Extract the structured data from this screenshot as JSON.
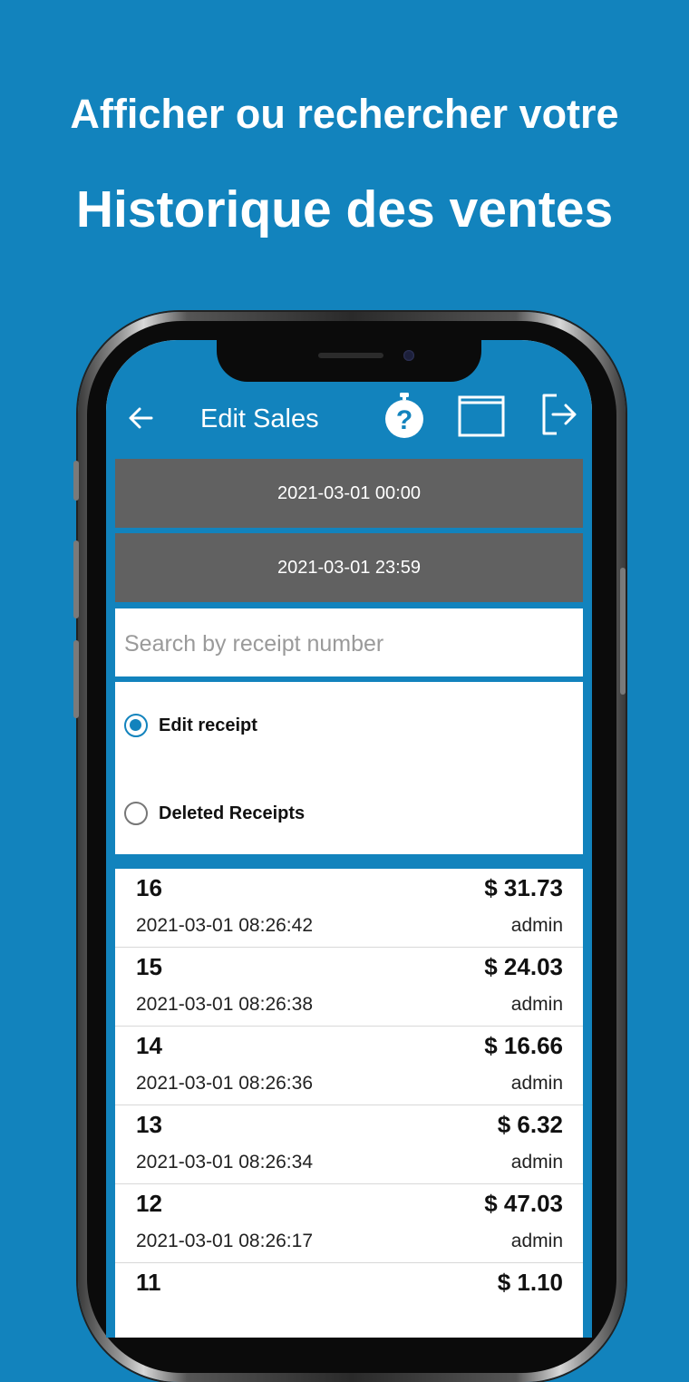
{
  "headline": {
    "line1": "Afficher ou rechercher votre",
    "line2": "Historique des ventes"
  },
  "appbar": {
    "title": "Edit Sales",
    "icons": [
      "back-arrow-icon",
      "help-icon",
      "window-icon",
      "logout-icon"
    ]
  },
  "filters": {
    "start_datetime": "2021-03-01 00:00",
    "end_datetime": "2021-03-01 23:59",
    "search_placeholder": "Search by receipt number",
    "search_value": ""
  },
  "mode": {
    "options": [
      {
        "label": "Edit receipt",
        "selected": true
      },
      {
        "label": "Deleted Receipts",
        "selected": false
      }
    ]
  },
  "receipts": [
    {
      "number": "16",
      "amount": "$ 31.73",
      "datetime": "2021-03-01 08:26:42",
      "user": "admin"
    },
    {
      "number": "15",
      "amount": "$ 24.03",
      "datetime": "2021-03-01 08:26:38",
      "user": "admin"
    },
    {
      "number": "14",
      "amount": "$ 16.66",
      "datetime": "2021-03-01 08:26:36",
      "user": "admin"
    },
    {
      "number": "13",
      "amount": "$ 6.32",
      "datetime": "2021-03-01 08:26:34",
      "user": "admin"
    },
    {
      "number": "12",
      "amount": "$ 47.03",
      "datetime": "2021-03-01 08:26:17",
      "user": "admin"
    },
    {
      "number": "11",
      "amount": "$ 1.10",
      "datetime": "",
      "user": ""
    }
  ],
  "colors": {
    "brand_blue": "#1283bd",
    "date_button_gray": "#616161"
  }
}
